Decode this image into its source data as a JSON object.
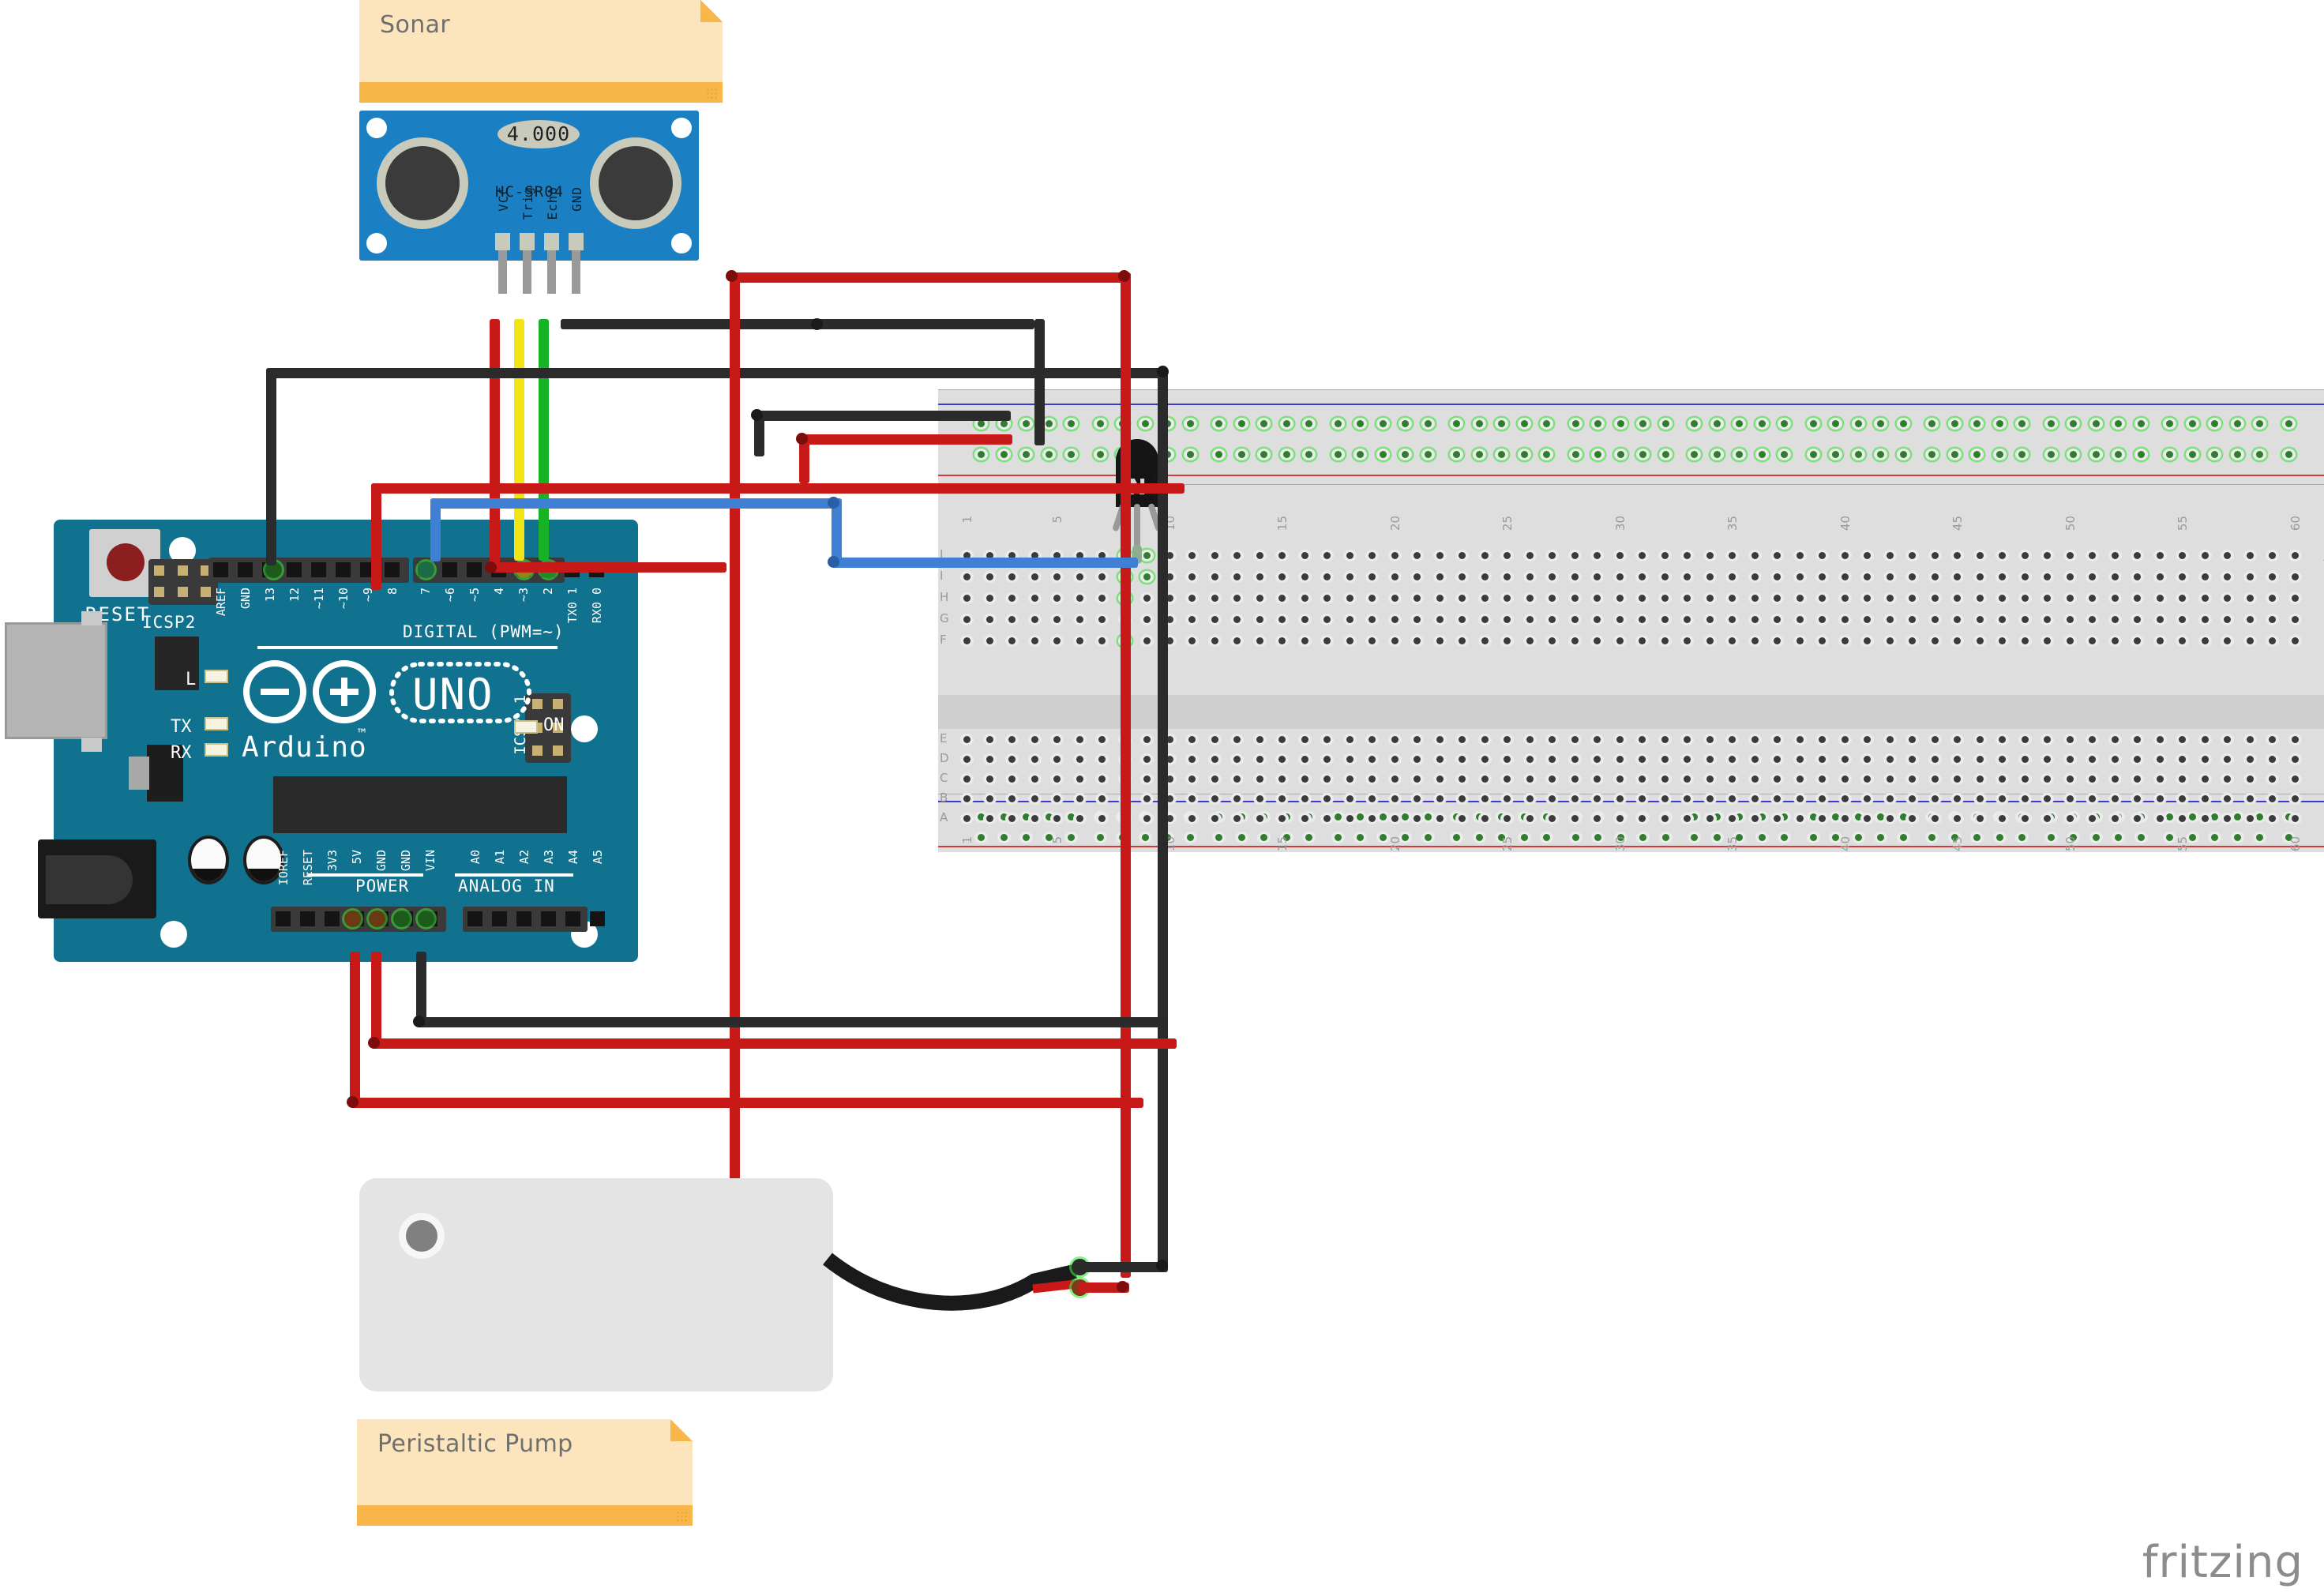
{
  "app": {
    "watermark": "fritzing"
  },
  "notes": [
    {
      "id": "sonar-note",
      "label": "Sonar"
    },
    {
      "id": "pump-note",
      "label": "Peristaltic Pump"
    }
  ],
  "sonar": {
    "part_number": "HC-SR04",
    "oscillator": "4.000",
    "pins": [
      "VCC",
      "Trig",
      "Echo",
      "GND"
    ]
  },
  "arduino": {
    "brand": "Arduino",
    "trademark": "™",
    "model": "UNO",
    "reset_label": "RESET",
    "icsp2_label": "ICSP2",
    "icsp_label": "ICSP",
    "icsp_pin1": "1",
    "leds": [
      "L",
      "TX",
      "RX",
      "ON"
    ],
    "digital_header_label": "DIGITAL  (PWM=~)",
    "digital_pins": [
      "AREF",
      "GND",
      "13",
      "12",
      "~11",
      "~10",
      "~9",
      "8",
      "7",
      "~6",
      "~5",
      "4",
      "~3",
      "2",
      "TX0 1",
      "RX0 0"
    ],
    "power_header_label": "POWER",
    "power_pins": [
      "IOREF",
      "RESET",
      "3V3",
      "5V",
      "GND",
      "GND",
      "VIN"
    ],
    "analog_header_label": "ANALOG IN",
    "analog_pins": [
      "A0",
      "A1",
      "A2",
      "A3",
      "A4",
      "A5"
    ]
  },
  "breadboard": {
    "row_labels_top": [
      "J",
      "I",
      "H",
      "G",
      "F"
    ],
    "row_labels_bottom": [
      "E",
      "D",
      "C",
      "B",
      "A"
    ],
    "column_ticks": [
      1,
      5,
      10,
      15,
      20,
      25,
      30,
      35,
      40,
      45,
      50,
      55,
      60
    ],
    "columns": 60
  },
  "transistor": {
    "marking": "N",
    "type": "NPN"
  },
  "wire_colors": {
    "power_5v": "#c81919",
    "ground": "#2b2b2b",
    "signal_trig": "#f2e514",
    "signal_echo": "#17b226",
    "signal_base": "#3f7fd4"
  },
  "connections": [
    {
      "from": "sonar.VCC",
      "to": "arduino.5V",
      "color": "#c81919"
    },
    {
      "from": "sonar.Trig",
      "to": "arduino.digital.3",
      "color": "#f2e514"
    },
    {
      "from": "sonar.Echo",
      "to": "arduino.digital.2",
      "color": "#17b226"
    },
    {
      "from": "sonar.GND",
      "to": "arduino.GND",
      "color": "#2b2b2b"
    },
    {
      "from": "arduino.digital.7",
      "to": "transistor.base",
      "color": "#3f7fd4"
    },
    {
      "from": "arduino.5V",
      "to": "breadboard.top_rail_positive",
      "color": "#c81919"
    },
    {
      "from": "arduino.GND",
      "to": "breadboard.top_rail_negative",
      "color": "#2b2b2b"
    },
    {
      "from": "pump.positive",
      "to": "breadboard.rail_positive",
      "color": "#c81919"
    },
    {
      "from": "pump.negative",
      "to": "transistor.collector",
      "color": "#2b2b2b"
    }
  ]
}
